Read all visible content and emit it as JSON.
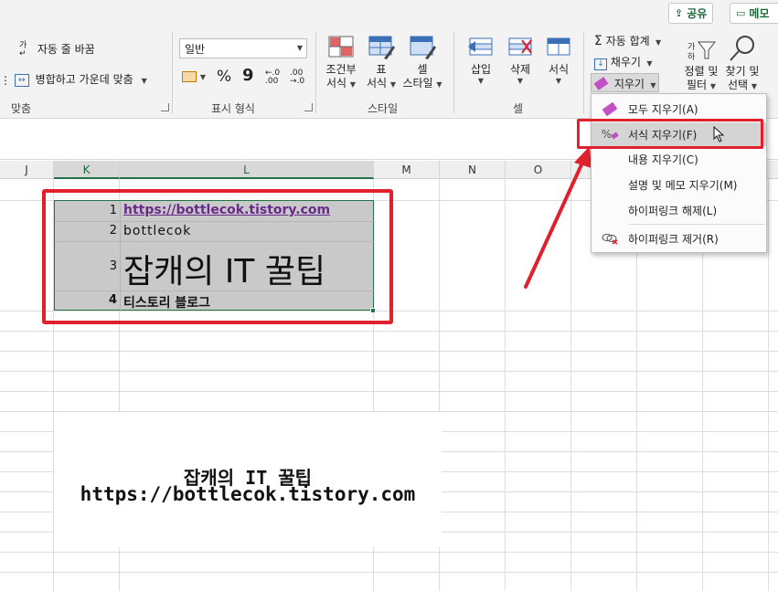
{
  "ribbon": {
    "share_label": "공유",
    "memo_label": "메모",
    "alignment": {
      "wrap_text": "자동 줄 바꿈",
      "merge_center": "병합하고 가운데 맞춤",
      "group_label": "맞춤"
    },
    "number": {
      "format_value": "일반",
      "percent": "%",
      "comma": "9",
      "inc_decimal": "←.0\n.00",
      "group_label": "표시 형식"
    },
    "styles": {
      "conditional_1": "조건부",
      "conditional_2": "서식",
      "table_1": "표",
      "table_2": "서식",
      "cell_1": "셀",
      "cell_2": "스타일",
      "group_label": "스타일"
    },
    "cells": {
      "insert": "삽입",
      "delete": "삭제",
      "format": "서식",
      "group_label": "셀"
    },
    "editing": {
      "autosum": "자동 합계",
      "fill": "채우기",
      "clear": "지우기",
      "sort_1": "정렬 및",
      "sort_2": "필터",
      "find_1": "찾기 및",
      "find_2": "선택"
    }
  },
  "columns": [
    "J",
    "K",
    "L",
    "M",
    "N",
    "O"
  ],
  "cells": [
    {
      "num": "1",
      "text": "https://bottlecok.tistory.com"
    },
    {
      "num": "2",
      "text": "bottlecok"
    },
    {
      "num": "3",
      "text": "잡캐의 IT 꿀팁"
    },
    {
      "num": "4",
      "text": "티스토리 블로그"
    }
  ],
  "image": {
    "line1": "잡캐의 IT 꿀팁",
    "line2": "https://bottlecok.tistory.com"
  },
  "menu": {
    "items": [
      {
        "label": "모두 지우기(A)"
      },
      {
        "label": "서식 지우기(F)"
      },
      {
        "label": "내용 지우기(C)"
      },
      {
        "label": "설명 및 메모 지우기(M)"
      },
      {
        "label": "하이퍼링크 해제(L)"
      },
      {
        "label": "하이퍼링크 제거(R)"
      }
    ]
  },
  "colors": {
    "accent": "#217346",
    "highlight": "#e0202c"
  }
}
